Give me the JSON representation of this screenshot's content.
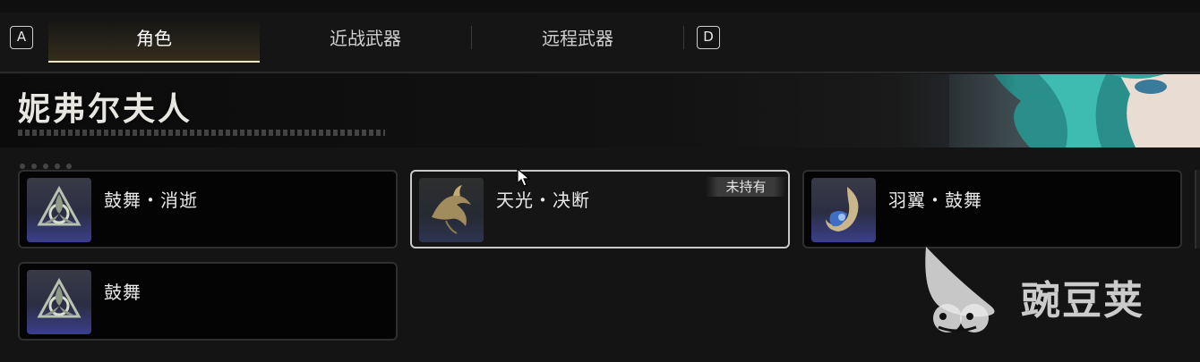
{
  "tabs": {
    "left_key": "A",
    "right_key": "D",
    "items": [
      {
        "label": "角色",
        "active": true
      },
      {
        "label": "近战武器",
        "active": false
      },
      {
        "label": "远程武器",
        "active": false
      }
    ]
  },
  "banner": {
    "title": "妮弗尔夫人"
  },
  "cards": [
    {
      "name": "鼓舞・消逝",
      "icon": "tri-knot-emblem-icon",
      "selected": false
    },
    {
      "name": "天光・决断",
      "icon": "dragon-emblem-icon",
      "selected": true,
      "badge": "未持有"
    },
    {
      "name": "羽翼・鼓舞",
      "icon": "wing-swirl-emblem-icon",
      "selected": false
    },
    {
      "name": "鼓舞",
      "icon": "tri-knot-emblem-icon",
      "selected": false
    }
  ],
  "watermark": {
    "text": "豌豆荚"
  },
  "colors": {
    "accent": "#f0e6c4",
    "selected_border": "#c9c9c9",
    "card_bg": "#040404"
  }
}
